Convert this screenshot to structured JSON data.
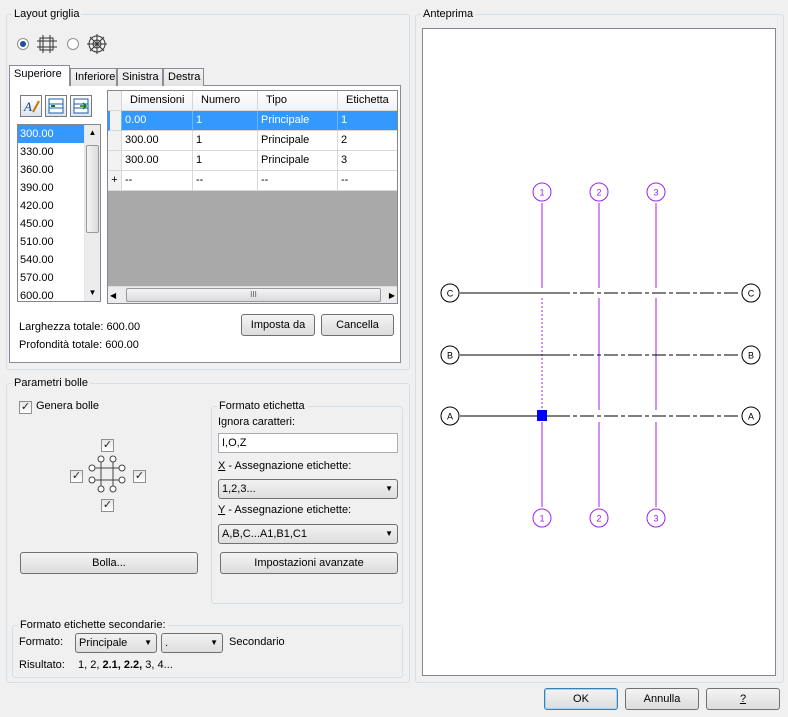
{
  "layout_group": {
    "title": "Layout griglia"
  },
  "radio_options": [
    {
      "icon": "orthogonal-grid-icon",
      "selected": true
    },
    {
      "icon": "radial-grid-icon",
      "selected": false
    }
  ],
  "tabs": [
    {
      "label": "Superiore",
      "active": true
    },
    {
      "label": "Inferiore",
      "active": false
    },
    {
      "label": "Sinistra",
      "active": false
    },
    {
      "label": "Destra",
      "active": false
    }
  ],
  "toolbar_icons": [
    "auto-fill-icon",
    "insert-row-icon",
    "append-row-icon"
  ],
  "dimension_list": [
    "300.00",
    "330.00",
    "360.00",
    "390.00",
    "420.00",
    "450.00",
    "510.00",
    "540.00",
    "570.00",
    "600.00"
  ],
  "grid_table": {
    "headers": [
      "Dimensioni",
      "Numero",
      "Tipo",
      "Etichetta"
    ],
    "rows": [
      [
        "0.00",
        "1",
        "Principale",
        "1"
      ],
      [
        "300.00",
        "1",
        "Principale",
        "2"
      ],
      [
        "300.00",
        "1",
        "Principale",
        "3"
      ]
    ],
    "new_row_marker": "+",
    "new_row": [
      "--",
      "--",
      "--",
      "--"
    ],
    "hscroll_grip": "III"
  },
  "totals": {
    "width_label": "Larghezza totale: 600.00",
    "depth_label": "Profondità totale: 600.00"
  },
  "buttons": {
    "set_as": "Imposta da",
    "delete": "Cancella",
    "bubble": "Bolla...",
    "advanced": "Impostazioni avanzate",
    "ok": "OK",
    "cancel": "Annulla",
    "help": "?"
  },
  "bubble_group": {
    "title": "Parametri bolle",
    "generate_label": "Genera bolle",
    "generate_checked": true
  },
  "label_format": {
    "title": "Formato etichetta",
    "ignore_label": "Ignora caratteri:",
    "ignore_value": "I,O,Z",
    "x_label": "- Assegnazione etichette:",
    "x_prefix": "X",
    "x_value": "1,2,3...",
    "y_label": "- Assegnazione etichette:",
    "y_prefix": "Y",
    "y_value": "A,B,C...A1,B1,C1"
  },
  "secondary_format": {
    "title": "Formato etichette secondarie:",
    "format_label": "Formato:",
    "format_value": "Principale",
    "separator_value": ".",
    "secondary_label": "Secondario",
    "result_label": "Risultato:",
    "result_plain_1": "1, 2, ",
    "result_bold": "2.1, 2.2,",
    "result_plain_2": " 3, 4..."
  },
  "preview": {
    "title": "Anteprima",
    "column_labels": [
      "1",
      "2",
      "3"
    ],
    "row_labels": [
      "C",
      "B",
      "A"
    ],
    "colors": {
      "columns": "#a020f0",
      "rows": "#000000",
      "marker": "#0000ff"
    }
  }
}
